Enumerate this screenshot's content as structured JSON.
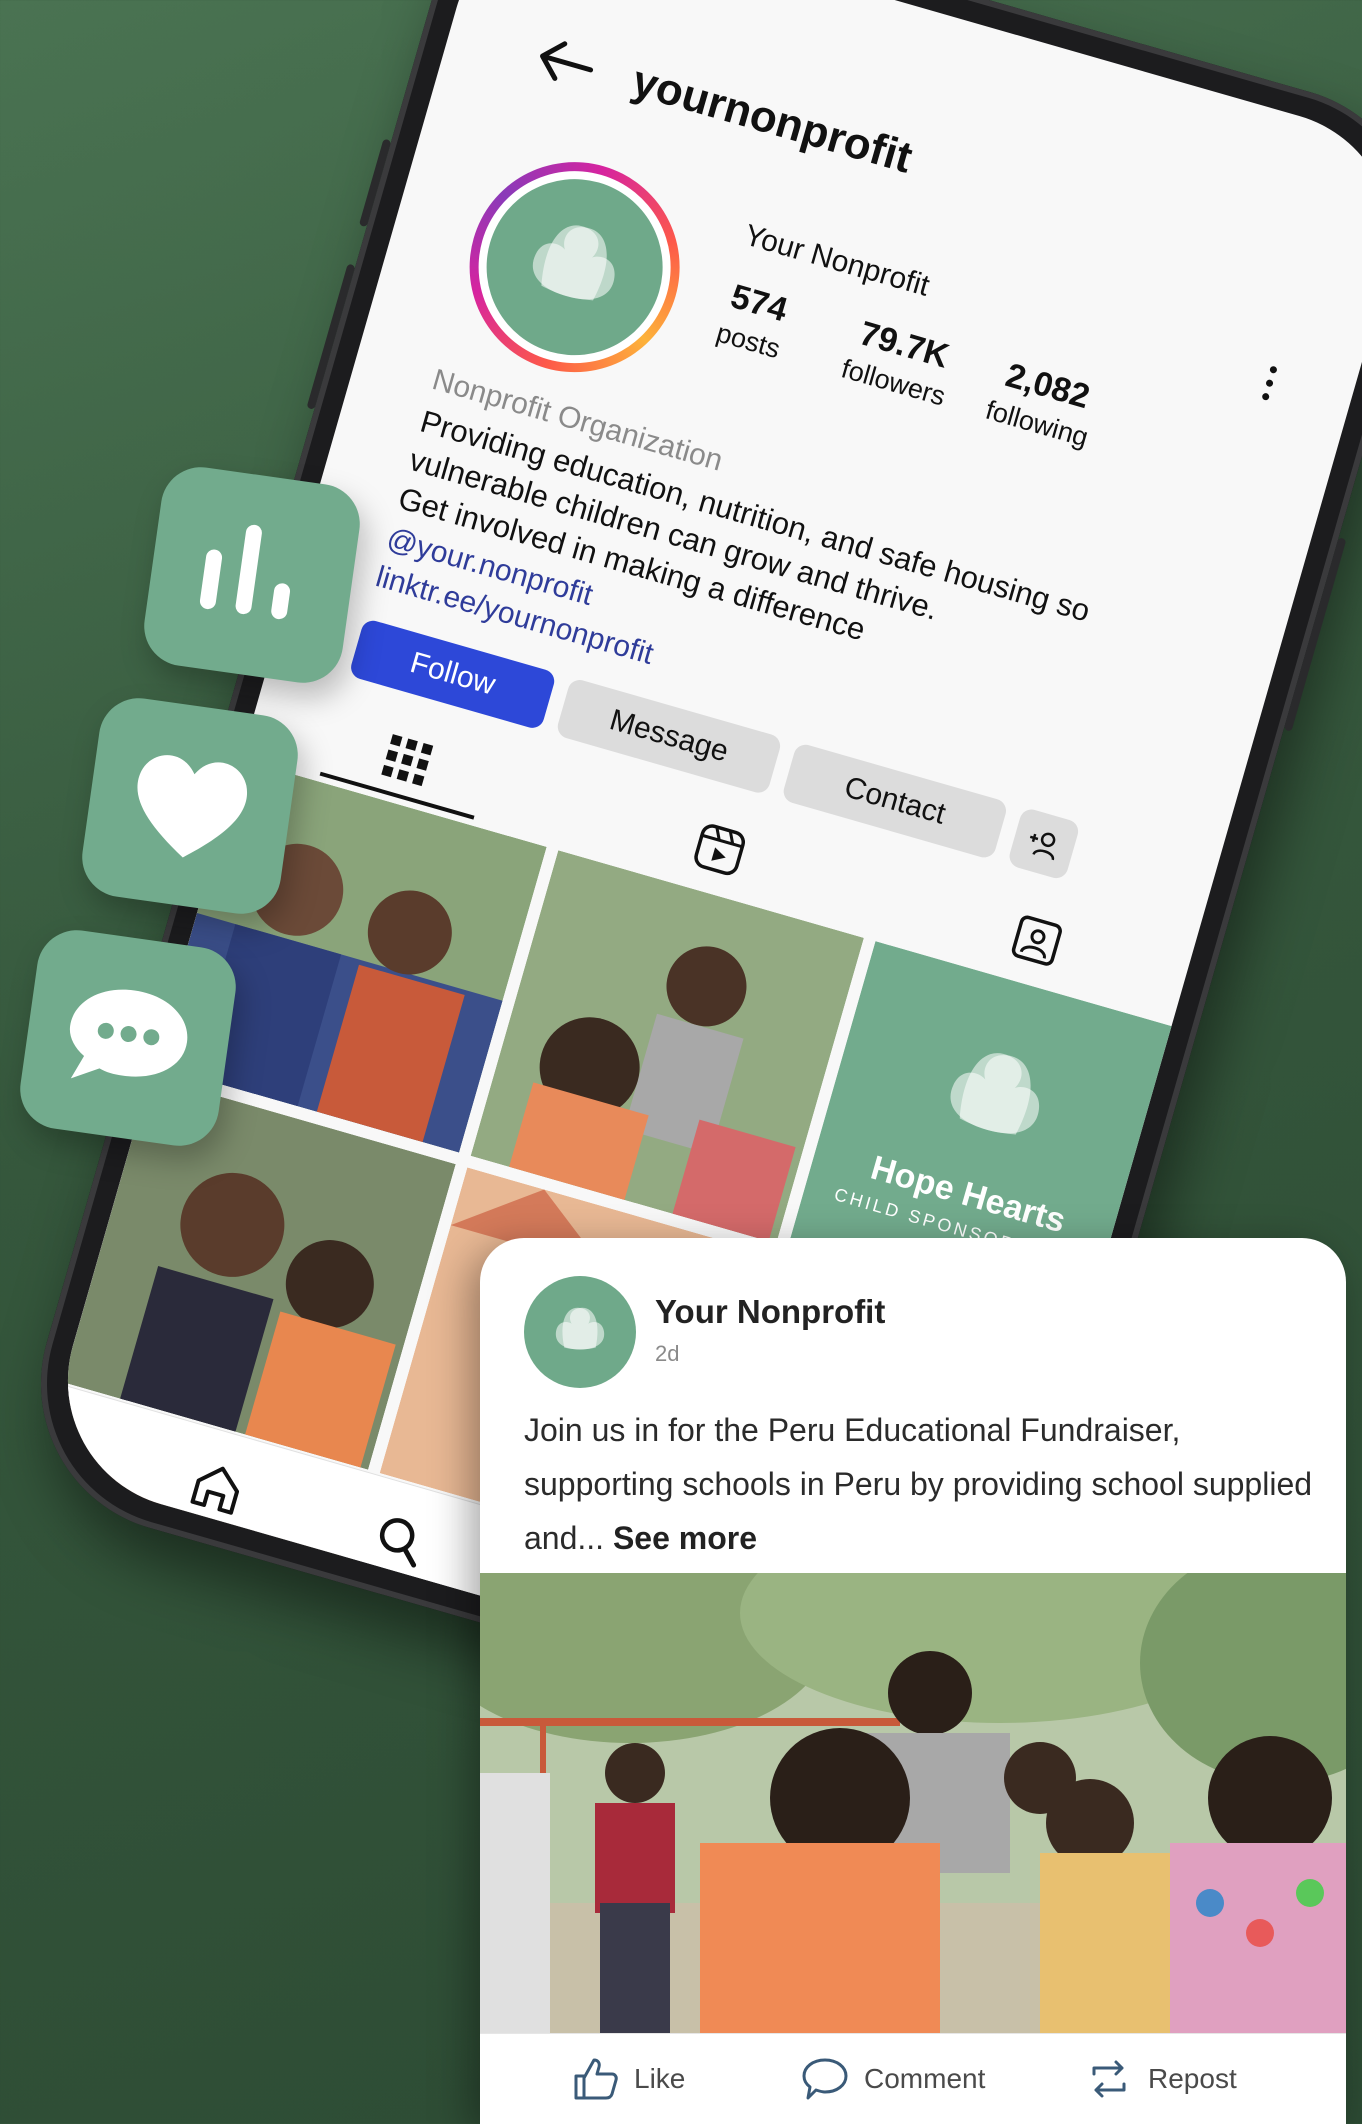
{
  "profile": {
    "username": "yournonprofit",
    "display_name": "Your Nonprofit",
    "stats": [
      {
        "value": "574",
        "label": "posts"
      },
      {
        "value": "79.7K",
        "label": "followers"
      },
      {
        "value": "2,082",
        "label": "following"
      }
    ],
    "category": "Nonprofit Organization",
    "bio_lines": [
      "Providing education, nutrition, and safe housing so",
      "vulnerable children can grow and thrive.",
      "Get involved in making a difference"
    ],
    "handle_link": "@your.nonprofit",
    "external_link": "linktr.ee/yournonprofit",
    "buttons": {
      "follow": "Follow",
      "message": "Message",
      "contact": "Contact"
    }
  },
  "grid_tile": {
    "title": "Hope Hearts",
    "subtitle": "CHILD SPONSORSHIPS"
  },
  "post": {
    "author": "Your Nonprofit",
    "time": "2d",
    "text": "Join us in for the Peru Educational Fundraiser, supporting schools in Peru by providing school supplied and...",
    "see_more": "See more",
    "actions": {
      "like": "Like",
      "comment": "Comment",
      "repost": "Repost"
    }
  },
  "colors": {
    "background": "#35573c",
    "brand_green": "#72ab8d",
    "follow_blue": "#2d48d8",
    "link_blue": "#2f3c9a"
  },
  "icons": [
    "back-arrow-icon",
    "kebab-menu-icon",
    "grid-icon",
    "reels-icon",
    "tagged-icon",
    "add-user-icon",
    "home-icon",
    "search-icon",
    "plus-square-icon",
    "bar-chart-icon",
    "heart-icon",
    "speech-bubble-icon",
    "like-icon",
    "comment-icon",
    "repost-icon"
  ]
}
